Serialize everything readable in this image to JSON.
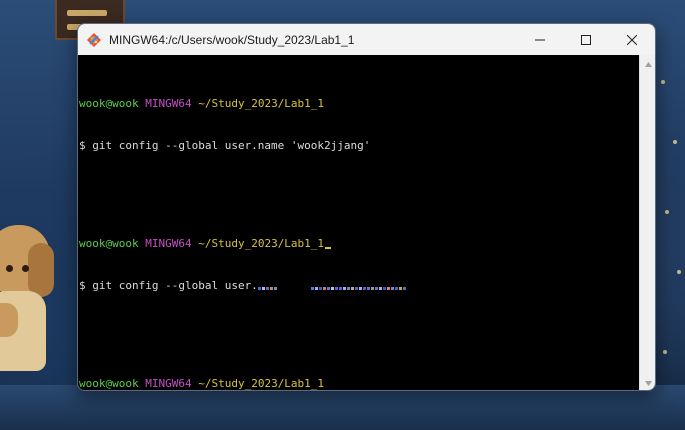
{
  "window": {
    "title": "MINGW64:/c/Users/wook/Study_2023/Lab1_1",
    "controls": [
      "minimize",
      "maximize",
      "close"
    ]
  },
  "terminal": {
    "lines": [
      {
        "type": "prompt",
        "user": "wook@wook",
        "shell": "MINGW64",
        "path": "~/Study_2023/Lab1_1"
      },
      {
        "type": "command",
        "text": "$ git config --global user.name 'wook2jjang'"
      },
      {
        "type": "gap"
      },
      {
        "type": "prompt",
        "user": "wook@wook",
        "shell": "MINGW64",
        "path": "~/Study_2023/Lab1_1"
      },
      {
        "type": "command-redacted",
        "text": "$ git config --global user."
      },
      {
        "type": "gap"
      },
      {
        "type": "prompt",
        "user": "wook@wook",
        "shell": "MINGW64",
        "path": "~/Study_2023/Lab1_1"
      },
      {
        "type": "input",
        "text": "$"
      }
    ]
  },
  "colors": {
    "prompt_user": "#5ccf4b",
    "prompt_shell": "#c550c4",
    "prompt_path": "#d8c340",
    "terminal_bg": "#000000",
    "titlebar_bg": "#f3f3f3"
  },
  "icons": {
    "app": "git-bash-icon",
    "minimize": "minimize-icon",
    "maximize": "maximize-icon",
    "close": "close-icon"
  }
}
